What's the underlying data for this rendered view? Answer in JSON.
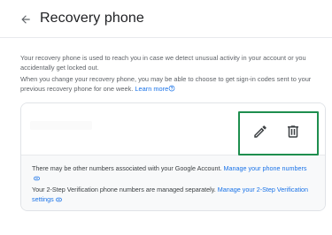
{
  "header": {
    "back_icon": "arrow-back-icon",
    "title": "Recovery phone"
  },
  "intro": {
    "paragraph1": "Your recovery phone is used to reach you in case we detect unusual activity in your account or you accidentally get locked out.",
    "paragraph2_text": "When you change your recovery phone, you may be able to choose to get sign-in codes sent to your previous recovery phone for one week. ",
    "learn_more_label": "Learn more",
    "help_icon": "help-circle-icon"
  },
  "phone_card": {
    "edit_icon": "pencil-icon",
    "delete_icon": "trash-icon",
    "note1_text": "There may be other numbers associated with your Google Account. ",
    "note1_link": "Manage your phone numbers",
    "note2_text": "Your 2-Step Verification phone numbers are managed separately. ",
    "note2_link": "Manage your 2-Step Verification settings",
    "external_icon": "link-icon"
  },
  "colors": {
    "link": "#1a73e8",
    "highlight_border": "#1e8e4e",
    "title_text": "#202124",
    "body_text": "#5f6368"
  }
}
